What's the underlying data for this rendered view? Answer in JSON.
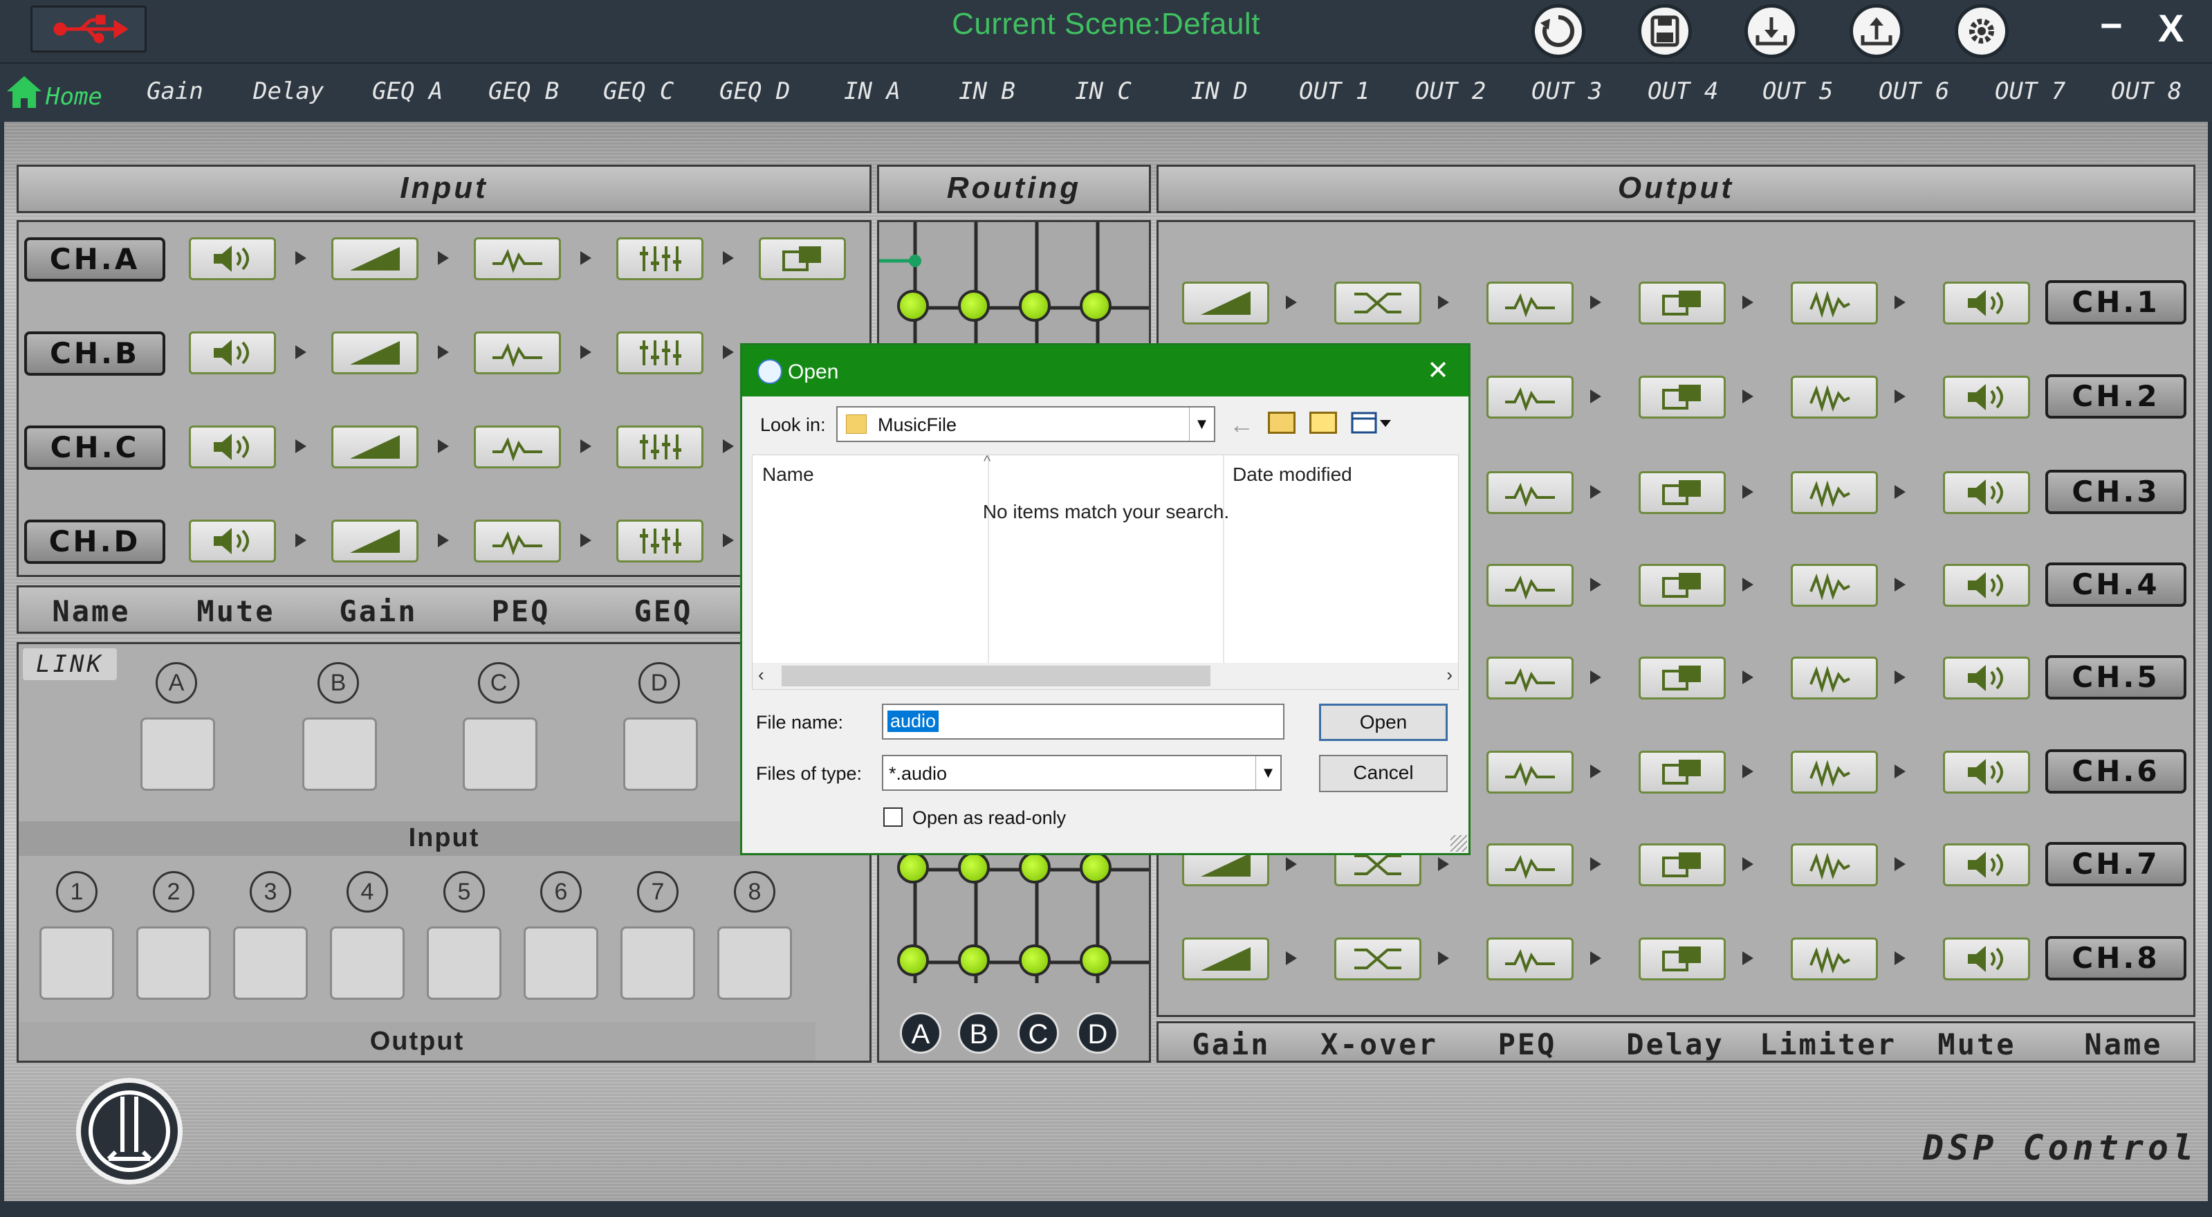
{
  "app": {
    "title": "Current Scene:Default",
    "brand": "DSP Control",
    "accent": "#40c060"
  },
  "window_controls": {
    "minimize": "−",
    "close": "X"
  },
  "toolbar_icons": [
    "refresh-icon",
    "save-icon",
    "download-icon",
    "upload-icon",
    "settings-icon"
  ],
  "nav": {
    "home": "Home",
    "tabs": [
      "Gain",
      "Delay",
      "GEQ A",
      "GEQ B",
      "GEQ C",
      "GEQ D",
      "IN A",
      "IN B",
      "IN C",
      "IN D",
      "OUT 1",
      "OUT 2",
      "OUT 3",
      "OUT 4",
      "OUT 5",
      "OUT 6",
      "OUT 7",
      "OUT 8"
    ]
  },
  "input": {
    "header": "Input",
    "channels": [
      "CH.A",
      "CH.B",
      "CH.C",
      "CH.D"
    ],
    "columns": [
      "Name",
      "Mute",
      "Gain",
      "PEQ",
      "GEQ"
    ]
  },
  "routing": {
    "header": "Routing",
    "letters": [
      "A",
      "B",
      "C",
      "D"
    ]
  },
  "output": {
    "header": "Output",
    "channels": [
      "CH.1",
      "CH.2",
      "CH.3",
      "CH.4",
      "CH.5",
      "CH.6",
      "CH.7",
      "CH.8"
    ],
    "columns": [
      "Gain",
      "X-over",
      "PEQ",
      "Delay",
      "Limiter",
      "Mute",
      "Name"
    ]
  },
  "link": {
    "label": "LINK",
    "input_letters": [
      "A",
      "B",
      "C",
      "D"
    ],
    "input_label": "Input",
    "output_numbers": [
      "1",
      "2",
      "3",
      "4",
      "5",
      "6",
      "7",
      "8"
    ],
    "output_label": "Output"
  },
  "dialog": {
    "title": "Open",
    "look_in_label": "Look in:",
    "look_in_value": "MusicFile",
    "col_name": "Name",
    "col_date": "Date modified",
    "empty": "No items match your search.",
    "file_name_label": "File name:",
    "file_name_value": "audio",
    "files_type_label": "Files of type:",
    "files_type_value": "*.audio",
    "open_btn": "Open",
    "cancel_btn": "Cancel",
    "readonly_label": "Open as read-only",
    "readonly_checked": false
  }
}
